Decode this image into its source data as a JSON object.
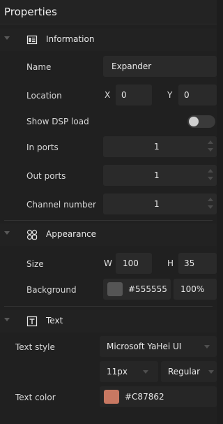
{
  "panel": {
    "title": "Properties"
  },
  "sections": {
    "information": {
      "title": "Information",
      "name_label": "Name",
      "name_value": "Expander",
      "location_label": "Location",
      "x_axis": "X",
      "x_value": "0",
      "y_axis": "Y",
      "y_value": "0",
      "dsp_label": "Show DSP load",
      "dsp_enabled": false,
      "in_ports_label": "In ports",
      "in_ports_value": "1",
      "out_ports_label": "Out ports",
      "out_ports_value": "1",
      "channel_label": "Channel number",
      "channel_value": "1"
    },
    "appearance": {
      "title": "Appearance",
      "size_label": "Size",
      "w_axis": "W",
      "w_value": "100",
      "h_axis": "H",
      "h_value": "35",
      "background_label": "Background",
      "background_hex": "#555555",
      "background_opacity": "100%"
    },
    "text": {
      "title": "Text",
      "style_label": "Text style",
      "font_family": "Microsoft YaHei UI",
      "font_size": "11px",
      "font_weight": "Regular",
      "color_label": "Text color",
      "color_hex": "#C87862"
    }
  },
  "icons": {
    "information": "info-card-icon",
    "appearance": "appearance-grid-icon",
    "text": "text-box-icon"
  },
  "colors": {
    "panel_bg": "#202020",
    "field_bg": "#2a2a2a",
    "background_swatch": "#555555",
    "text_swatch": "#C87862"
  }
}
